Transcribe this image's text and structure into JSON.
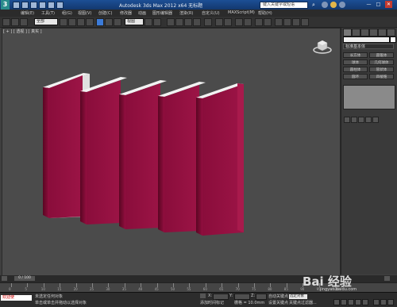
{
  "title_bar": {
    "app_letter": "3",
    "title": "Autodesk 3ds Max 2012 x64    无标题",
    "search_placeholder": "键入关键字或短语",
    "window_controls": [
      "—",
      "□",
      "✕"
    ]
  },
  "menu": [
    "编辑(E)",
    "工具(T)",
    "组(G)",
    "视图(V)",
    "创建(C)",
    "修改器",
    "动画",
    "图形编辑器",
    "渲染(R)",
    "自定义(U)",
    "MAXScript(M)",
    "帮助(H)"
  ],
  "toolbar": {
    "selection_filter": "全部",
    "reference_coord": "视图"
  },
  "viewport": {
    "label": "[ + ] [ 透视 ] [ 真实 ]",
    "book_color": "#8e0f3c",
    "page_color": "#eaeaea"
  },
  "command_panel": {
    "object_type_dropdown": "标准基本体",
    "buttons": [
      "长方体",
      "圆锥体",
      "球体",
      "几何球体",
      "圆柱体",
      "管状体",
      "圆环",
      "四棱锥",
      "茶壶",
      "平面"
    ],
    "swatch_color": "#ffffff"
  },
  "timeline": {
    "frame_counter": "0 / 100",
    "ticks": [
      "0",
      "5",
      "10",
      "15",
      "20",
      "25",
      "30",
      "35",
      "40",
      "45",
      "50",
      "55",
      "60",
      "65",
      "70",
      "75",
      "80",
      "85",
      "90",
      "95",
      "100"
    ]
  },
  "status": {
    "maxscript": "欢迎使",
    "selection_line": "未选定任何对象",
    "prompt_line": "单击或单击并拖动以选择对象",
    "coord_x_label": "X:",
    "coord_y_label": "Y:",
    "coord_z_label": "Z:",
    "grid": "栅格 = 10.0mm",
    "auto_key": "自动关键点",
    "set_key": "设置关键点",
    "key_filter_value": "选定对象",
    "key_filters": "关键点过滤器...",
    "add_time_tag": "添加时间标记"
  },
  "watermark": {
    "brand": "Bai 经验",
    "url": "jingyan.baidu.com"
  }
}
